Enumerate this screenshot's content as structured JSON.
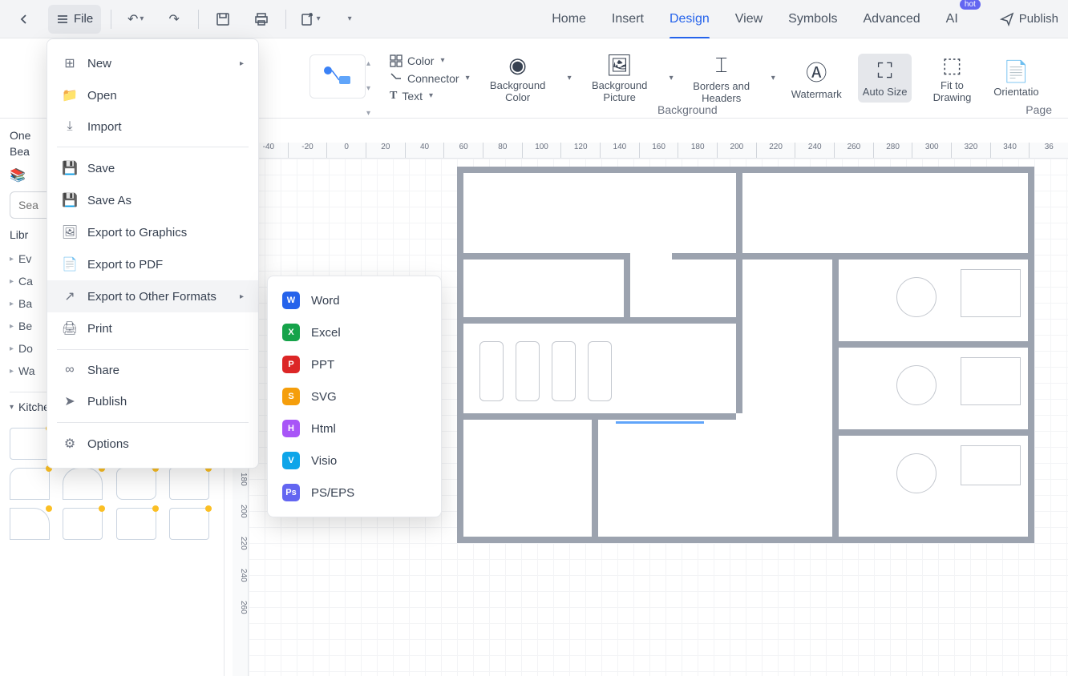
{
  "toolbar": {
    "file_label": "File",
    "publish_label": "Publish"
  },
  "tabs": [
    {
      "label": "Home"
    },
    {
      "label": "Insert"
    },
    {
      "label": "Design",
      "active": true
    },
    {
      "label": "View"
    },
    {
      "label": "Symbols"
    },
    {
      "label": "Advanced"
    },
    {
      "label": "AI",
      "badge": "hot"
    }
  ],
  "ribbon": {
    "color": "Color",
    "connector": "Connector",
    "text": "Text",
    "background_color": "Background Color",
    "background_picture": "Background Picture",
    "borders_headers": "Borders and Headers",
    "watermark": "Watermark",
    "auto_size": "Auto Size",
    "fit_drawing": "Fit to Drawing",
    "orientation": "Orientatio",
    "section_bg": "Background",
    "section_page": "Page"
  },
  "left_panel": {
    "doc_title_1": "One",
    "doc_title_2": "Bea",
    "search_placeholder": "Sea",
    "library_label": "Libr",
    "categories": [
      "Ev",
      "Ca",
      "Ba",
      "Be",
      "Do",
      "Wa"
    ],
    "shape_section_title": "Kitchen and Dining Room"
  },
  "file_menu": {
    "new": "New",
    "open": "Open",
    "import": "Import",
    "save": "Save",
    "save_as": "Save As",
    "export_graphics": "Export to Graphics",
    "export_pdf": "Export to PDF",
    "export_other": "Export to Other Formats",
    "print": "Print",
    "share": "Share",
    "publish": "Publish",
    "options": "Options"
  },
  "export_submenu": [
    {
      "label": "Word",
      "cls": "word",
      "abbr": "W"
    },
    {
      "label": "Excel",
      "cls": "excel",
      "abbr": "X"
    },
    {
      "label": "PPT",
      "cls": "ppt",
      "abbr": "P"
    },
    {
      "label": "SVG",
      "cls": "svg",
      "abbr": "S"
    },
    {
      "label": "Html",
      "cls": "html",
      "abbr": "H"
    },
    {
      "label": "Visio",
      "cls": "visio",
      "abbr": "V"
    },
    {
      "label": "PS/EPS",
      "cls": "ps",
      "abbr": "Ps"
    }
  ],
  "ruler_h": [
    "-40",
    "-20",
    "0",
    "20",
    "40",
    "60",
    "80",
    "100",
    "120",
    "140",
    "160",
    "180",
    "200",
    "220",
    "240",
    "260",
    "280",
    "300",
    "320",
    "340",
    "36"
  ],
  "ruler_v": [
    "180",
    "200",
    "220",
    "240",
    "260"
  ]
}
